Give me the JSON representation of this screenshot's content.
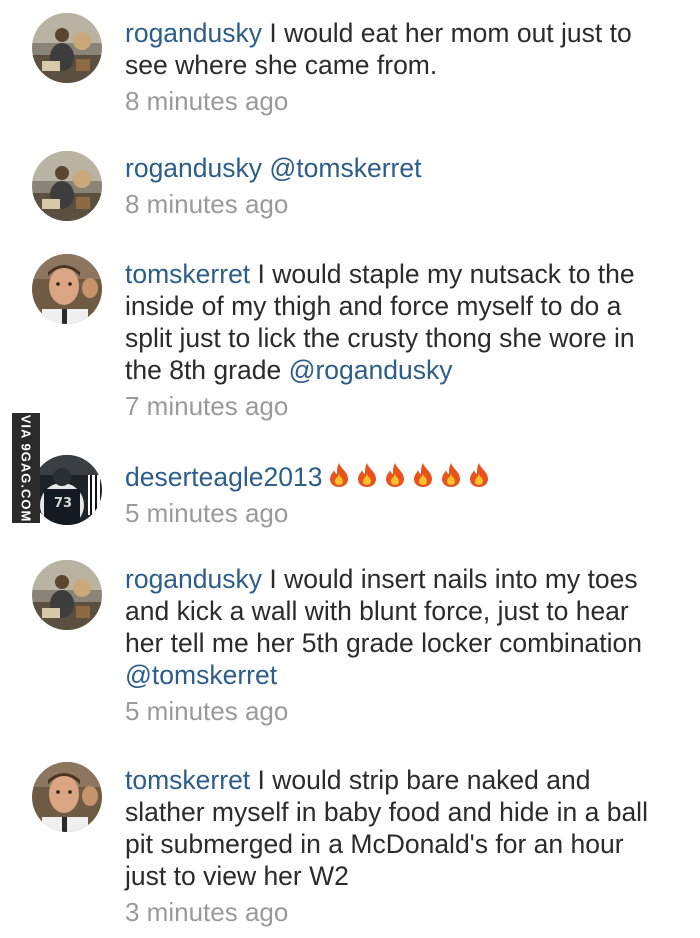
{
  "comments": [
    {
      "username": "rogandusky",
      "text": "I would eat her mom out just to see where she came from.",
      "mention": "",
      "timestamp": "8 minutes ago"
    },
    {
      "username": "rogandusky",
      "text": "",
      "mention": "@tomskerret",
      "timestamp": "8 minutes ago"
    },
    {
      "username": "tomskerret",
      "text": "I would staple my nutsack to the inside of my thigh and force myself to do a split just to lick the crusty thong she wore in the 8th grade",
      "mention": "@rogandusky",
      "timestamp": "7 minutes ago"
    },
    {
      "username": "deserteagle2013",
      "text": "",
      "mention": "",
      "fire_emoji_count": 6,
      "timestamp": "5 minutes ago"
    },
    {
      "username": "rogandusky",
      "text": "I would insert nails into my toes and kick a wall with blunt force, just to hear her tell me her 5th grade locker combination",
      "mention": "@tomskerret",
      "timestamp": "5 minutes ago"
    },
    {
      "username": "tomskerret",
      "text": "I would strip bare naked and slather myself in baby food and hide in a ball pit submerged in a McDonald's for an hour just to view her W2",
      "mention": "",
      "timestamp": "3 minutes ago"
    }
  ],
  "watermark": {
    "text": "VIA 9GAG.COM"
  },
  "colors": {
    "username": "#2d5d8a",
    "text": "#2b2b2b",
    "timestamp": "#9a9a9a",
    "fire": "#e8521c"
  }
}
